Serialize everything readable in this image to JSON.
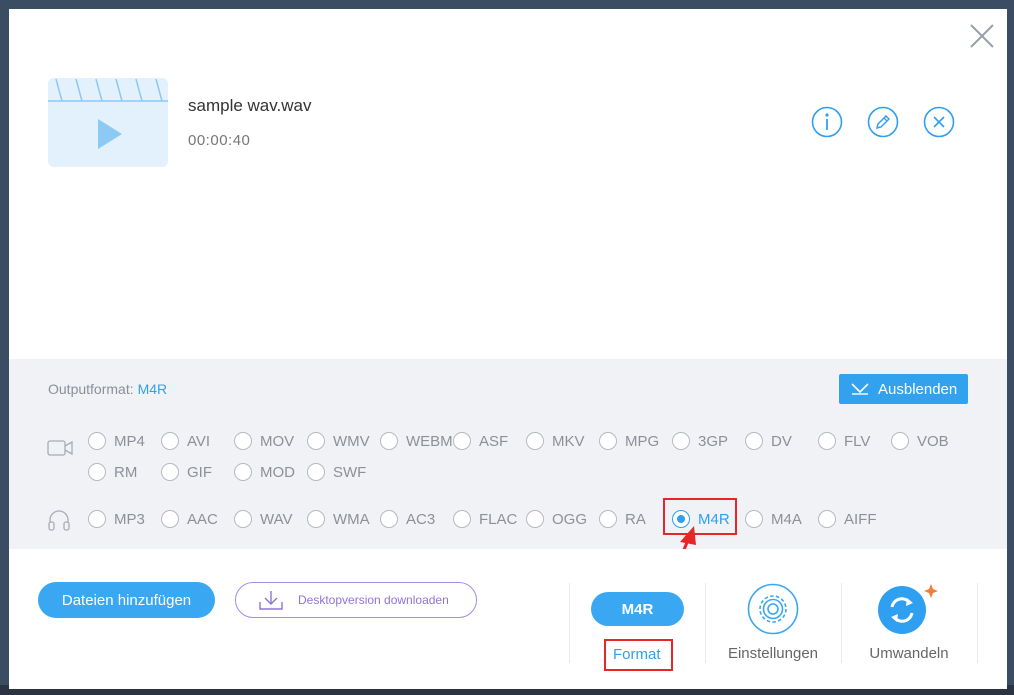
{
  "file": {
    "name": "sample wav.wav",
    "duration": "00:00:40"
  },
  "output": {
    "label": "Outputformat:",
    "value": "M4R"
  },
  "hide_button": {
    "label": "Ausblenden"
  },
  "video_formats": [
    "MP4",
    "AVI",
    "MOV",
    "WMV",
    "WEBM",
    "ASF",
    "MKV",
    "MPG",
    "3GP",
    "DV",
    "FLV",
    "VOB",
    "RM",
    "GIF",
    "MOD",
    "SWF"
  ],
  "audio_formats": [
    "MP3",
    "AAC",
    "WAV",
    "WMA",
    "AC3",
    "FLAC",
    "OGG",
    "RA",
    "M4R",
    "M4A",
    "AIFF"
  ],
  "selected_format": "M4R",
  "footer": {
    "add_files": "Dateien hinzufügen",
    "desktop_download": "Desktopversion downloaden",
    "format_pill": "M4R",
    "format_label": "Format",
    "settings_label": "Einstellungen",
    "convert_label": "Umwandeln"
  },
  "colors": {
    "accent": "#32a2ef",
    "highlight": "#e8262a",
    "panel_bg": "#f0f2f5",
    "convert_star": "#f07f3c"
  },
  "icons": {
    "close": "close-icon",
    "info": "info-icon",
    "edit": "pencil-icon",
    "remove": "remove-icon",
    "video_category": "video-camera-icon",
    "audio_category": "headphones-icon",
    "settings": "gear-icon",
    "convert": "convert-icon",
    "download": "download-icon"
  }
}
